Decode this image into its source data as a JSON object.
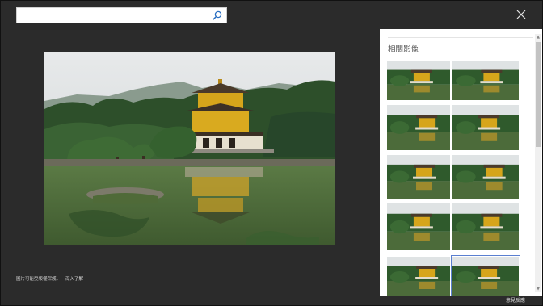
{
  "search": {
    "value": "",
    "placeholder": ""
  },
  "icons": {
    "search": "search-icon",
    "close": "close-icon"
  },
  "main_image": {
    "alt": ""
  },
  "disclaimer": {
    "text": "圖片可能受版權保護。",
    "learn_more": "深入了解"
  },
  "related": {
    "title": "相關影像",
    "thumbnails": [
      {
        "id": 1,
        "selected": false
      },
      {
        "id": 2,
        "selected": false
      },
      {
        "id": 3,
        "selected": false
      },
      {
        "id": 4,
        "selected": false
      },
      {
        "id": 5,
        "selected": false
      },
      {
        "id": 6,
        "selected": false
      },
      {
        "id": 7,
        "selected": false
      },
      {
        "id": 8,
        "selected": false
      },
      {
        "id": 9,
        "selected": false
      },
      {
        "id": 10,
        "selected": true
      }
    ]
  },
  "feedback": {
    "label": "意見反應"
  },
  "colors": {
    "background": "#2b2b2b",
    "panel": "#ffffff",
    "gold": "#d4a017",
    "sky": "#dcdfe1",
    "foliage": "#2f5d2c",
    "water": "#4e6b3a"
  }
}
